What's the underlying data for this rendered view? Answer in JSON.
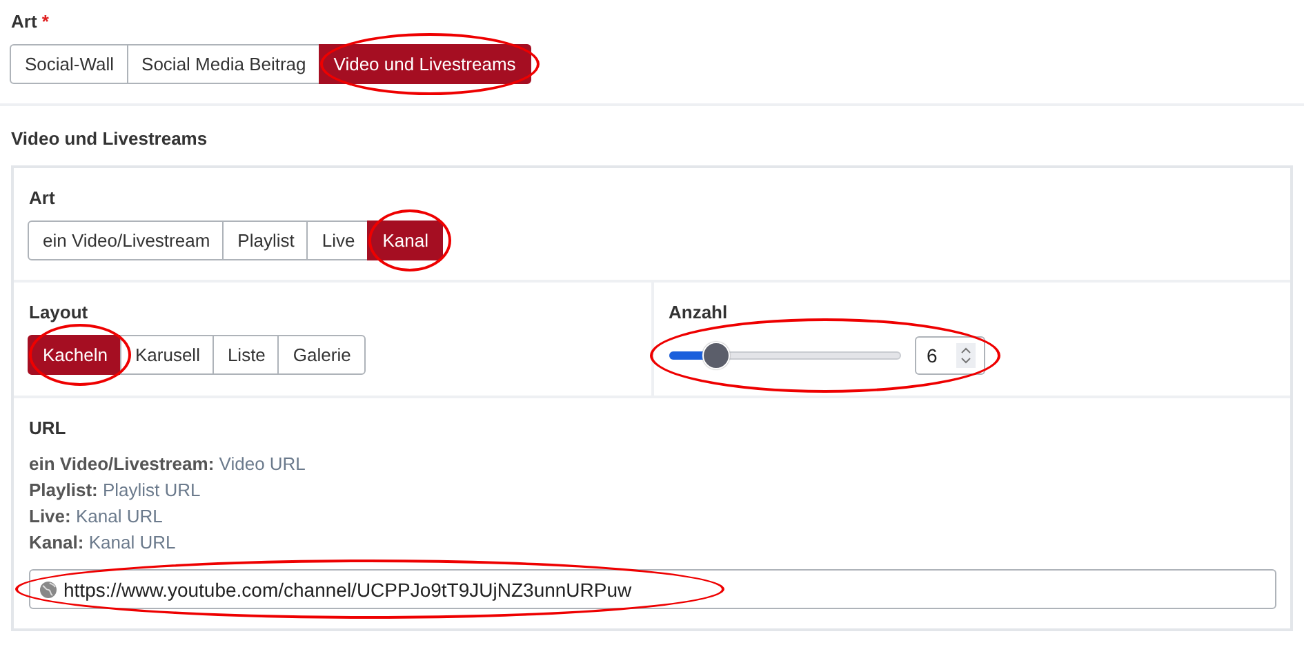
{
  "type_field": {
    "label": "Art",
    "required_mark": "*",
    "options": [
      {
        "label": "Social-Wall",
        "selected": false,
        "annotated": false
      },
      {
        "label": "Social Media Beitrag",
        "selected": false,
        "annotated": false
      },
      {
        "label": "Video und Livestreams",
        "selected": true,
        "annotated": true
      }
    ]
  },
  "section": {
    "title": "Video und Livestreams",
    "kind_field": {
      "label": "Art",
      "options": [
        {
          "label": "ein Video/Livestream",
          "selected": false,
          "annotated": false
        },
        {
          "label": "Playlist",
          "selected": false,
          "annotated": false
        },
        {
          "label": "Live",
          "selected": false,
          "annotated": false
        },
        {
          "label": "Kanal",
          "selected": true,
          "annotated": true
        }
      ]
    },
    "layout_field": {
      "label": "Layout",
      "options": [
        {
          "label": "Kacheln",
          "selected": true,
          "annotated": true
        },
        {
          "label": "Karusell",
          "selected": false,
          "annotated": false
        },
        {
          "label": "Liste",
          "selected": false,
          "annotated": false
        },
        {
          "label": "Galerie",
          "selected": false,
          "annotated": false
        }
      ]
    },
    "count_field": {
      "label": "Anzahl",
      "level": 0.2,
      "value": "6",
      "annotated": true
    },
    "url_field": {
      "label": "URL",
      "hints": [
        {
          "term": "ein Video/Livestream:",
          "text": "Video URL"
        },
        {
          "term": "Playlist:",
          "text": "Playlist URL"
        },
        {
          "term": "Live:",
          "text": "Kanal URL"
        },
        {
          "term": "Kanal:",
          "text": "Kanal URL"
        }
      ],
      "value": "https://www.youtube.com/channel/UCPPJo9tT9JUjNZ3unnURPuw",
      "annotated": true
    }
  }
}
